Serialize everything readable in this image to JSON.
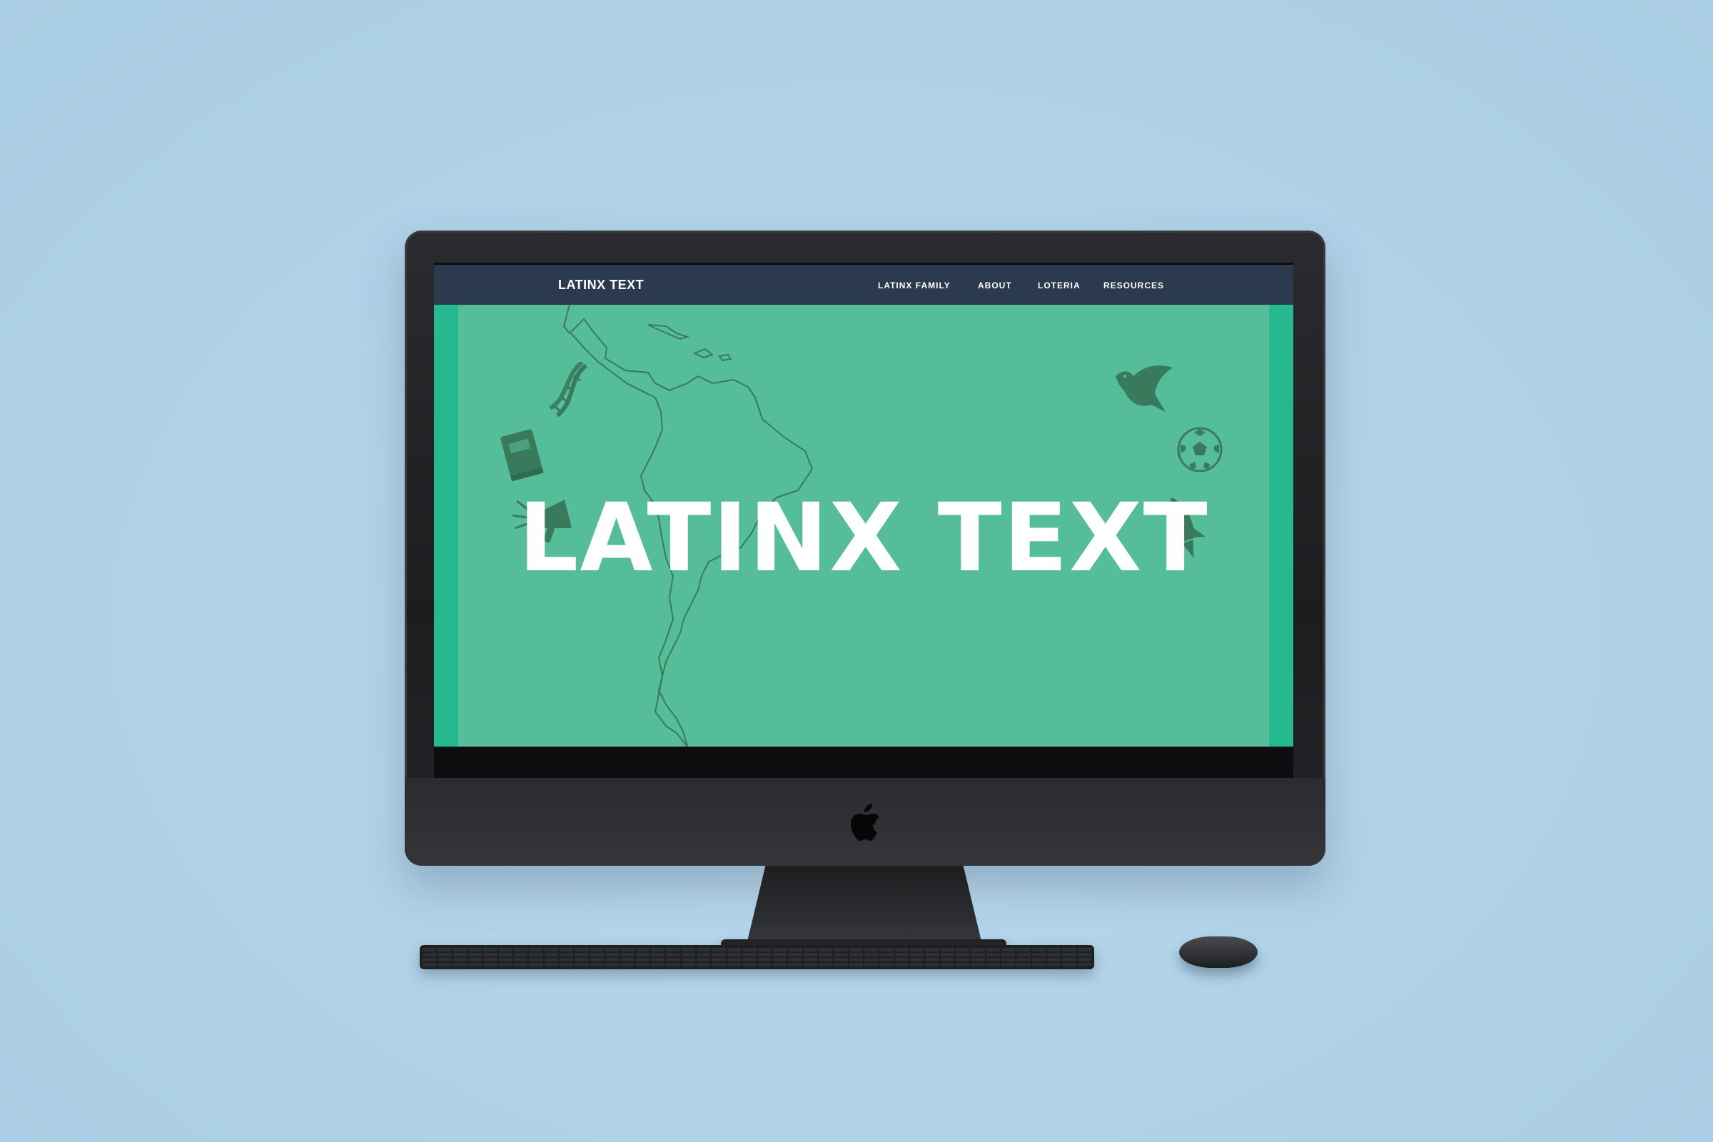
{
  "navbar": {
    "brand": "LATINX TEXT",
    "links": [
      "LATINX FAMILY",
      "ABOUT",
      "LOTERIA",
      "RESOURCES"
    ]
  },
  "hero": {
    "title": "LATINX TEXT",
    "icons": [
      "dna-icon",
      "book-icon",
      "megaphone-icon",
      "dove-icon",
      "soccer-ball-icon",
      "rocket-icon"
    ]
  },
  "colors": {
    "navbar": "#2b3a4e",
    "hero": "#55bd9a",
    "stripe": "#26b98f",
    "icon": "#3a7a5c",
    "background": "#b0d2e8"
  },
  "device": {
    "logo": "apple-logo"
  }
}
